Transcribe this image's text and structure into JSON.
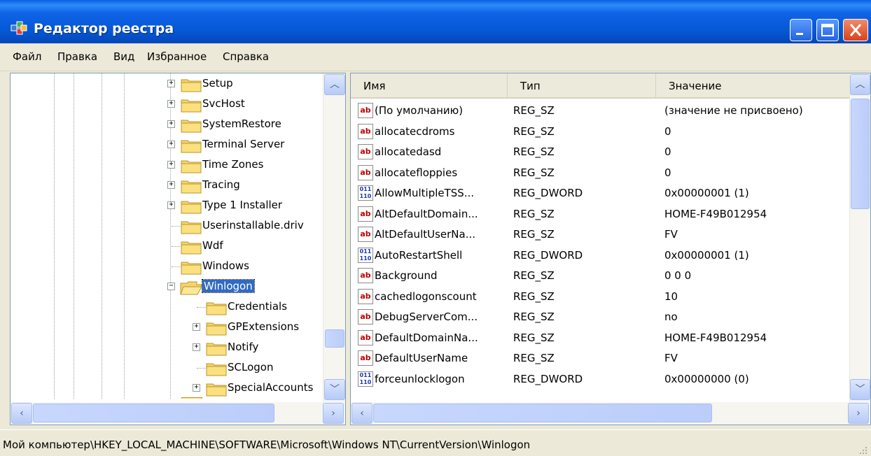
{
  "window": {
    "title": "Редактор реестра"
  },
  "menu": [
    {
      "label": "Файл"
    },
    {
      "label": "Правка"
    },
    {
      "label": "Вид"
    },
    {
      "label": "Избранное"
    },
    {
      "label": "Справка"
    }
  ],
  "tree": {
    "items": [
      {
        "label": "Setup",
        "expander": "+",
        "depth": 0
      },
      {
        "label": "SvcHost",
        "expander": "+",
        "depth": 0
      },
      {
        "label": "SystemRestore",
        "expander": "+",
        "depth": 0
      },
      {
        "label": "Terminal Server",
        "expander": "+",
        "depth": 0
      },
      {
        "label": "Time Zones",
        "expander": "+",
        "depth": 0
      },
      {
        "label": "Tracing",
        "expander": "+",
        "depth": 0
      },
      {
        "label": "Type 1 Installer",
        "expander": "+",
        "depth": 0
      },
      {
        "label": "Userinstallable.driv",
        "expander": "",
        "depth": 0
      },
      {
        "label": "Wdf",
        "expander": "",
        "depth": 0
      },
      {
        "label": "Windows",
        "expander": "",
        "depth": 0
      },
      {
        "label": "Winlogon",
        "expander": "−",
        "depth": 0,
        "selected": true
      },
      {
        "label": "Credentials",
        "expander": "",
        "depth": 1
      },
      {
        "label": "GPExtensions",
        "expander": "+",
        "depth": 1
      },
      {
        "label": "Notify",
        "expander": "+",
        "depth": 1
      },
      {
        "label": "SCLogon",
        "expander": "",
        "depth": 1
      },
      {
        "label": "SpecialAccounts",
        "expander": "+",
        "depth": 1
      }
    ]
  },
  "list": {
    "columns": {
      "name": "Имя",
      "type": "Тип",
      "value": "Значение"
    },
    "rows": [
      {
        "icon": "string",
        "name": "(По умолчанию)",
        "type": "REG_SZ",
        "value": "(значение не присвоено)"
      },
      {
        "icon": "string",
        "name": "allocatecdroms",
        "type": "REG_SZ",
        "value": "0"
      },
      {
        "icon": "string",
        "name": "allocatedasd",
        "type": "REG_SZ",
        "value": "0"
      },
      {
        "icon": "string",
        "name": "allocatefloppies",
        "type": "REG_SZ",
        "value": "0"
      },
      {
        "icon": "dword",
        "name": "AllowMultipleTSS...",
        "type": "REG_DWORD",
        "value": "0x00000001 (1)"
      },
      {
        "icon": "string",
        "name": "AltDefaultDomain...",
        "type": "REG_SZ",
        "value": "HOME-F49B012954"
      },
      {
        "icon": "string",
        "name": "AltDefaultUserNa...",
        "type": "REG_SZ",
        "value": "FV"
      },
      {
        "icon": "dword",
        "name": "AutoRestartShell",
        "type": "REG_DWORD",
        "value": "0x00000001 (1)"
      },
      {
        "icon": "string",
        "name": "Background",
        "type": "REG_SZ",
        "value": "0 0 0"
      },
      {
        "icon": "string",
        "name": "cachedlogonscount",
        "type": "REG_SZ",
        "value": "10"
      },
      {
        "icon": "string",
        "name": "DebugServerCom...",
        "type": "REG_SZ",
        "value": "no"
      },
      {
        "icon": "string",
        "name": "DefaultDomainNa...",
        "type": "REG_SZ",
        "value": "HOME-F49B012954"
      },
      {
        "icon": "string",
        "name": "DefaultUserName",
        "type": "REG_SZ",
        "value": "FV"
      },
      {
        "icon": "dword",
        "name": "forceunlocklogon",
        "type": "REG_DWORD",
        "value": "0x00000000 (0)"
      }
    ]
  },
  "icons": {
    "string": "ab",
    "dword": "011 110"
  },
  "statusbar": {
    "path": "Мой компьютер\\HKEY_LOCAL_MACHINE\\SOFTWARE\\Microsoft\\Windows NT\\CurrentVersion\\Winlogon"
  }
}
